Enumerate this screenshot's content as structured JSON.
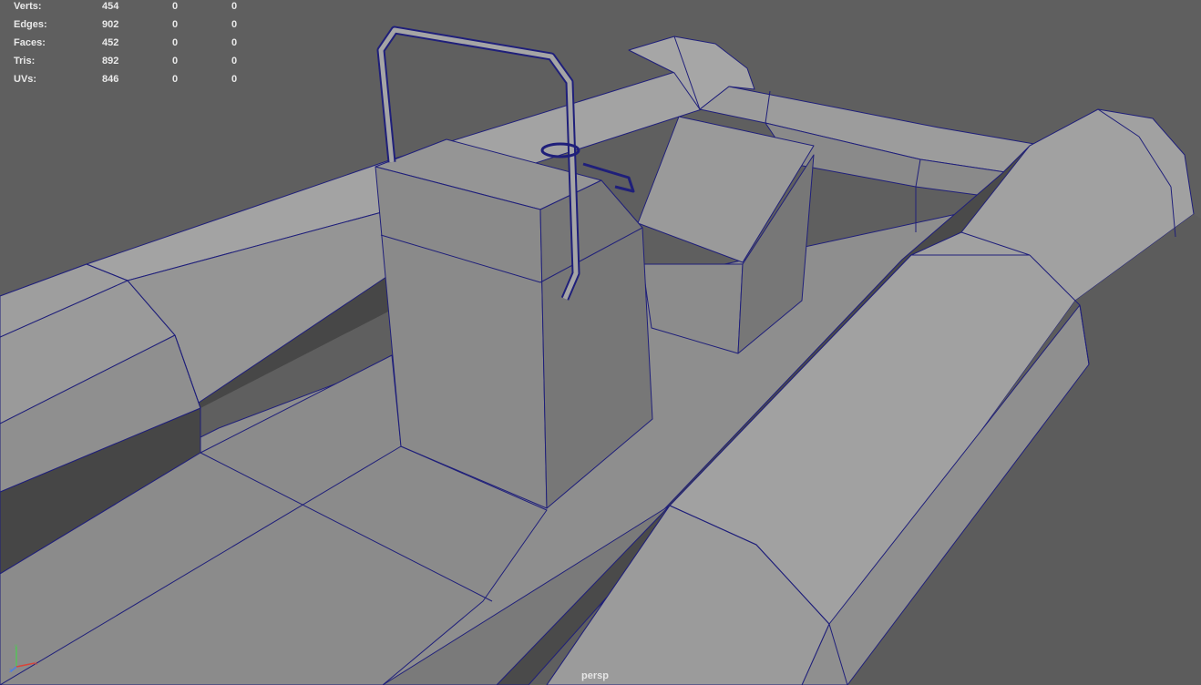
{
  "viewport": {
    "camera": "persp",
    "wire_color": "#1f1f7a",
    "background_color": "#5f5f5f"
  },
  "hud": {
    "rows": [
      {
        "label": "Verts:",
        "total": "454",
        "selected": "0",
        "components": "0"
      },
      {
        "label": "Edges:",
        "total": "902",
        "selected": "0",
        "components": "0"
      },
      {
        "label": "Faces:",
        "total": "452",
        "selected": "0",
        "components": "0"
      },
      {
        "label": "Tris:",
        "total": "892",
        "selected": "0",
        "components": "0"
      },
      {
        "label": "UVs:",
        "total": "846",
        "selected": "0",
        "components": "0"
      }
    ]
  },
  "axis_gizmo": {
    "icon": "xyz-axis-icon",
    "x_color": "#d9443a",
    "y_color": "#56c05a",
    "z_color": "#4f7fe0"
  }
}
